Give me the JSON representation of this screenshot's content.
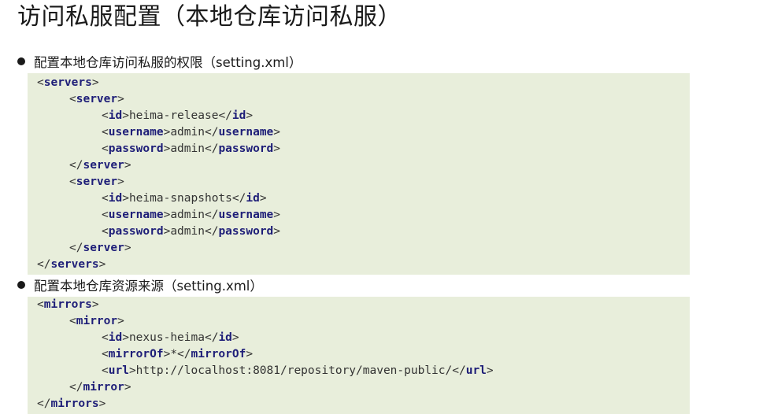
{
  "page": {
    "title": "访问私服配置（本地仓库访问私服）"
  },
  "sections": [
    {
      "label": "配置本地仓库访问私服的权限（setting.xml）",
      "lines": [
        {
          "indent": 0,
          "open": "servers"
        },
        {
          "indent": 1,
          "open": "server"
        },
        {
          "indent": 2,
          "open": "id",
          "text": "heima-release",
          "close": "id"
        },
        {
          "indent": 2,
          "open": "username",
          "text": "admin",
          "close": "username"
        },
        {
          "indent": 2,
          "open": "password",
          "text": "admin",
          "close": "password"
        },
        {
          "indent": 1,
          "close": "server"
        },
        {
          "indent": 1,
          "open": "server"
        },
        {
          "indent": 2,
          "open": "id",
          "text": "heima-snapshots",
          "close": "id"
        },
        {
          "indent": 2,
          "open": "username",
          "text": "admin",
          "close": "username"
        },
        {
          "indent": 2,
          "open": "password",
          "text": "admin",
          "close": "password"
        },
        {
          "indent": 1,
          "close": "server"
        },
        {
          "indent": 0,
          "close": "servers"
        }
      ]
    },
    {
      "label": "配置本地仓库资源来源（setting.xml）",
      "lines": [
        {
          "indent": 0,
          "open": "mirrors"
        },
        {
          "indent": 1,
          "open": "mirror"
        },
        {
          "indent": 2,
          "open": "id",
          "text": "nexus-heima",
          "close": "id"
        },
        {
          "indent": 2,
          "open": "mirrorOf",
          "text": "*",
          "close": "mirrorOf"
        },
        {
          "indent": 2,
          "open": "url",
          "text": "http://localhost:8081/repository/maven-public/",
          "close": "url"
        },
        {
          "indent": 1,
          "close": "mirror"
        },
        {
          "indent": 0,
          "close": "mirrors"
        }
      ]
    }
  ]
}
